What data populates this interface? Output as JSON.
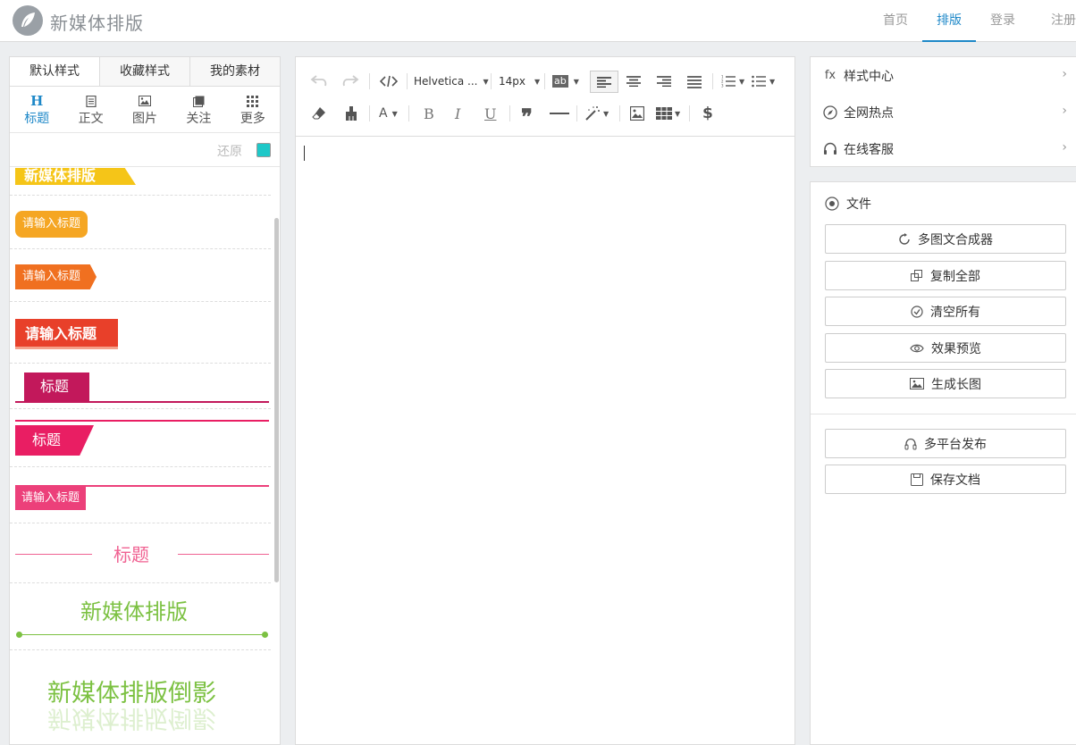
{
  "header": {
    "brand": "新媒体排版",
    "nav": [
      {
        "label": "首页",
        "active": false
      },
      {
        "label": "排版",
        "active": true
      },
      {
        "label": "登录",
        "active": false
      },
      {
        "label": "注册",
        "active": false
      }
    ]
  },
  "left": {
    "tabs": [
      "默认样式",
      "收藏样式",
      "我的素材"
    ],
    "categories": [
      {
        "label": "标题",
        "icon": "heading-icon"
      },
      {
        "label": "正文",
        "icon": "document-icon"
      },
      {
        "label": "图片",
        "icon": "image-icon"
      },
      {
        "label": "关注",
        "icon": "follow-icon"
      },
      {
        "label": "更多",
        "icon": "grid-icon"
      }
    ],
    "restore_label": "还原",
    "swatch_color": "#1ec8c8",
    "styles": [
      {
        "text": "新媒体排版",
        "color": "#f5c518"
      },
      {
        "text": "请输入标题",
        "color": "#f5a623"
      },
      {
        "text": "请输入标题",
        "color": "#f07020"
      },
      {
        "text": "请输入标题",
        "color": "#e8402a"
      },
      {
        "text": "标题",
        "color": "#c2185b"
      },
      {
        "text": "标题",
        "color": "#e91e63"
      },
      {
        "text": "请输入标题",
        "color": "#ec407a"
      },
      {
        "text": "标题",
        "color": "#f06292"
      },
      {
        "text": "新媒体排版",
        "color": "#7cc142"
      },
      {
        "text": "新媒体排版倒影",
        "color": "#7cc142"
      }
    ]
  },
  "toolbar": {
    "font_family": "Helvetica ...",
    "font_size": "14px",
    "highlight_label": "ab",
    "font_color_label": "A",
    "bold": "B",
    "italic": "I",
    "underline": "U",
    "dollar": "$"
  },
  "right": {
    "menu": [
      {
        "label": "样式中心",
        "icon": "fx-icon",
        "icon_text": "fx"
      },
      {
        "label": "全网热点",
        "icon": "compass-icon"
      },
      {
        "label": "在线客服",
        "icon": "headset-icon"
      }
    ],
    "file_label": "文件",
    "buttons": [
      {
        "label": "多图文合成器",
        "icon": "refresh-icon"
      },
      {
        "label": "复制全部",
        "icon": "copy-icon"
      },
      {
        "label": "清空所有",
        "icon": "clear-icon"
      },
      {
        "label": "效果预览",
        "icon": "eye-icon"
      },
      {
        "label": "生成长图",
        "icon": "picture-icon"
      }
    ],
    "buttons2": [
      {
        "label": "多平台发布",
        "icon": "headphones-icon"
      },
      {
        "label": "保存文档",
        "icon": "save-icon"
      }
    ]
  }
}
